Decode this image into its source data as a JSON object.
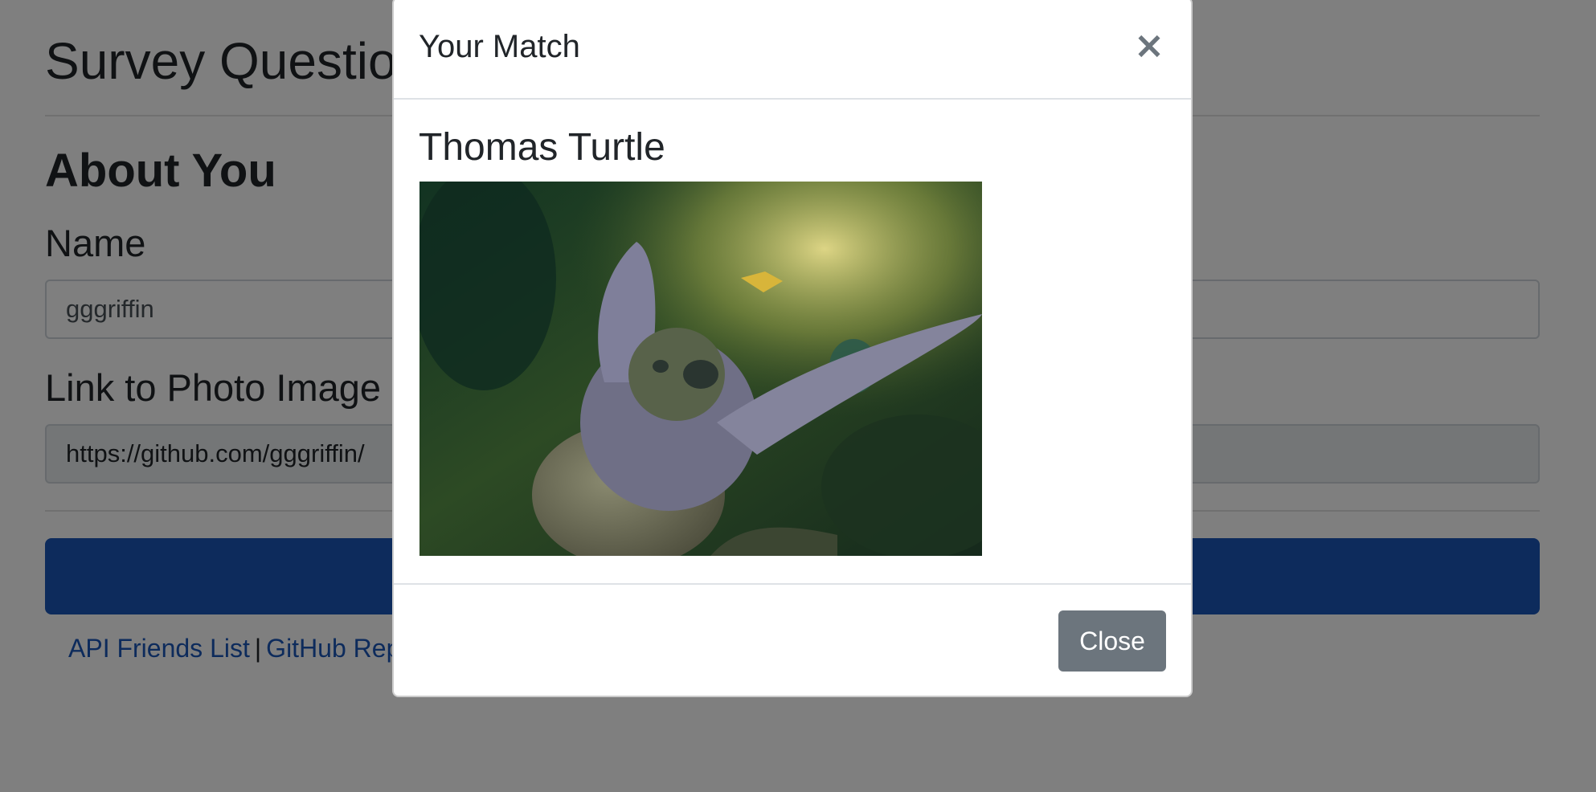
{
  "page": {
    "title": "Survey Questions",
    "section_title": "About You",
    "name_label": "Name",
    "name_value": "gggriffin",
    "photo_label": "Link to Photo Image",
    "photo_value": "https://github.com/gggriffin/",
    "submit_label": "",
    "footer": {
      "api_link": "API Friends List",
      "separator": "|",
      "github_link": "GitHub Rep"
    }
  },
  "modal": {
    "title": "Your Match",
    "close_glyph": "×",
    "match_name": "Thomas Turtle",
    "photo_subject": "sea-turtle-photo",
    "close_button": "Close"
  },
  "colors": {
    "primary": "#1b56b8",
    "secondary": "#6c757d",
    "backdrop": "rgba(0,0,0,0.5)"
  }
}
